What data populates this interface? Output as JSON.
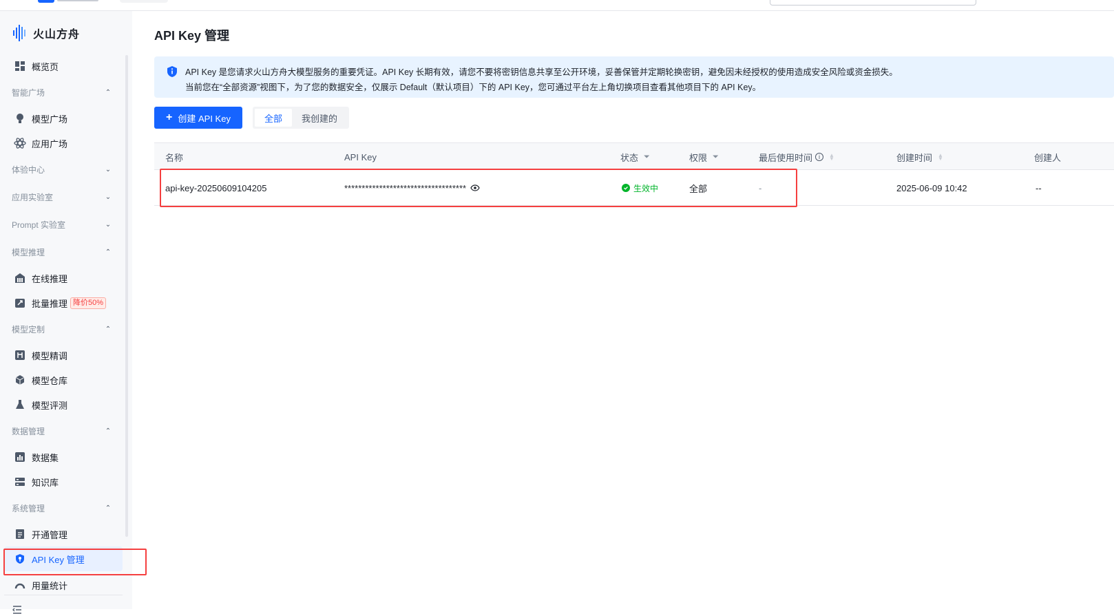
{
  "brand": {
    "name": "火山方舟"
  },
  "sidebar": {
    "overview": "概览页",
    "groups": [
      {
        "label": "智能广场",
        "expanded": true,
        "items": [
          {
            "label": "模型广场",
            "icon": "bulb-icon"
          },
          {
            "label": "应用广场",
            "icon": "atom-icon"
          }
        ]
      },
      {
        "label": "体验中心",
        "expanded": false,
        "items": []
      },
      {
        "label": "应用实验室",
        "expanded": false,
        "items": []
      },
      {
        "label": "Prompt 实验室",
        "expanded": false,
        "items": []
      },
      {
        "label": "模型推理",
        "expanded": true,
        "items": [
          {
            "label": "在线推理",
            "icon": "building-icon"
          },
          {
            "label": "批量推理",
            "icon": "rocket-icon",
            "badge": "降价50%"
          }
        ]
      },
      {
        "label": "模型定制",
        "expanded": true,
        "items": [
          {
            "label": "模型精调",
            "icon": "tune-icon"
          },
          {
            "label": "模型仓库",
            "icon": "cube-icon"
          },
          {
            "label": "模型评测",
            "icon": "flask-icon"
          }
        ]
      },
      {
        "label": "数据管理",
        "expanded": true,
        "items": [
          {
            "label": "数据集",
            "icon": "dataset-icon"
          },
          {
            "label": "知识库",
            "icon": "database-icon"
          }
        ]
      },
      {
        "label": "系统管理",
        "expanded": true,
        "items": [
          {
            "label": "开通管理",
            "icon": "document-icon"
          },
          {
            "label": "API Key 管理",
            "icon": "key-shield-icon",
            "active": true
          },
          {
            "label": "用量统计",
            "icon": "gauge-icon"
          }
        ]
      }
    ]
  },
  "page": {
    "title": "API Key 管理",
    "alert": {
      "line1": "API Key 是您请求火山方舟大模型服务的重要凭证。API Key 长期有效，请您不要将密钥信息共享至公开环境，妥善保管并定期轮换密钥，避免因未经授权的使用造成安全风险或资金损失。",
      "line2": "当前您在“全部资源”视图下，为了您的数据安全，仅展示 Default（默认项目）下的 API Key，您可通过平台左上角切换项目查看其他项目下的 API Key。"
    },
    "create_button": "创建 API Key",
    "filter_tabs": [
      "全部",
      "我创建的"
    ],
    "table": {
      "headers": {
        "name": "名称",
        "api_key": "API Key",
        "status": "状态",
        "permission": "权限",
        "last_used": "最后使用时间",
        "created_at": "创建时间",
        "creator": "创建人"
      },
      "rows": [
        {
          "name": "api-key-20250609104205",
          "api_key": "***********************************",
          "status": "生效中",
          "permission": "全部",
          "last_used": "-",
          "created_at": "2025-06-09 10:42",
          "creator": "--"
        }
      ]
    }
  },
  "colors": {
    "accent": "#1664ff",
    "success": "#00b42a",
    "highlight": "#f53f3f"
  }
}
